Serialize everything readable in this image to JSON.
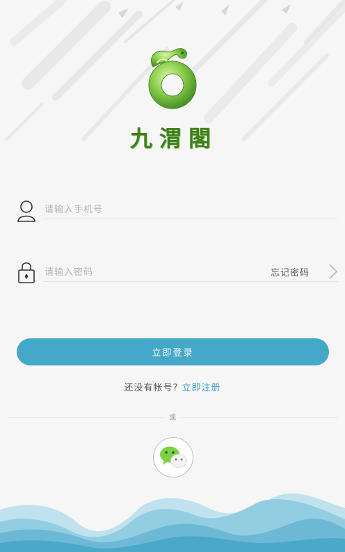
{
  "app": {
    "brand_name": "九渭閣"
  },
  "login": {
    "phone_placeholder": "请输入手机号",
    "password_placeholder": "请输入密码",
    "forgot_password": "忘记密码",
    "login_button": "立即登录",
    "no_account_text": "还没有帐号?",
    "register_link": "立即注册",
    "or_text": "或"
  },
  "social": {
    "wechat_icon": "wechat-icon"
  },
  "colors": {
    "accent": "#45a8c9",
    "link": "#3a9fc4",
    "wechat_green": "#7bd243",
    "brand_green": "#6fb63a"
  }
}
